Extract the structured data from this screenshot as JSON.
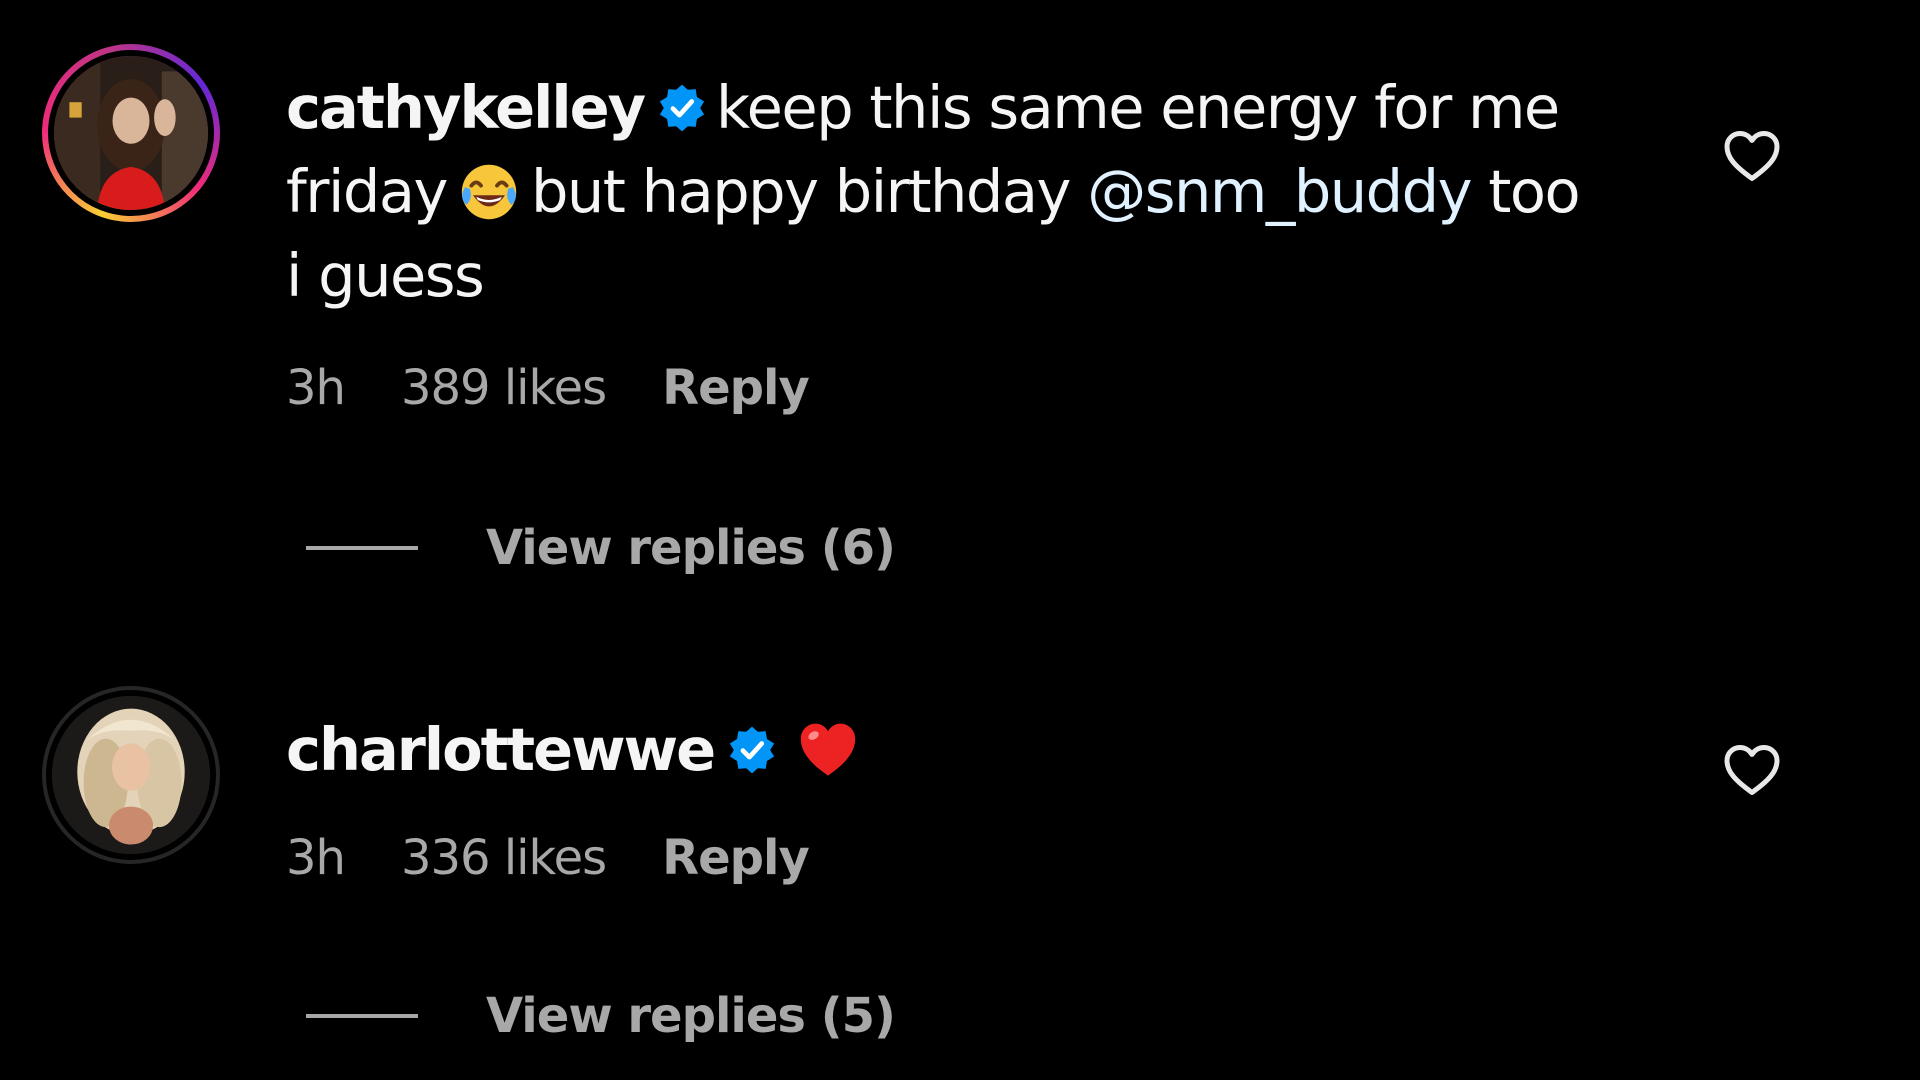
{
  "comments": [
    {
      "username": "cathykelley",
      "verified": true,
      "text_line1": "keep this same energy for me",
      "text_line2_start": "friday",
      "emoji1": "face-with-tears-of-joy",
      "text_line2_mid": "but happy birthday",
      "mention": "@snm_buddy",
      "text_line2_end": "too",
      "text_line3": "i guess",
      "time": "3h",
      "likes": "389 likes",
      "reply_label": "Reply",
      "view_replies": "View replies (6)"
    },
    {
      "username": "charlottewwe",
      "verified": true,
      "emoji": "red-heart",
      "time": "3h",
      "likes": "336 likes",
      "reply_label": "Reply",
      "view_replies": "View replies (5)"
    }
  ],
  "colors": {
    "background": "#000000",
    "text": "#f5f5f5",
    "secondary_text": "#a8a8a8",
    "verified_blue": "#0095f6",
    "mention": "#e0f1ff",
    "heart_red": "#ed2323"
  },
  "icons": {
    "like": "heart-outline-icon",
    "verified": "verified-badge-icon"
  }
}
